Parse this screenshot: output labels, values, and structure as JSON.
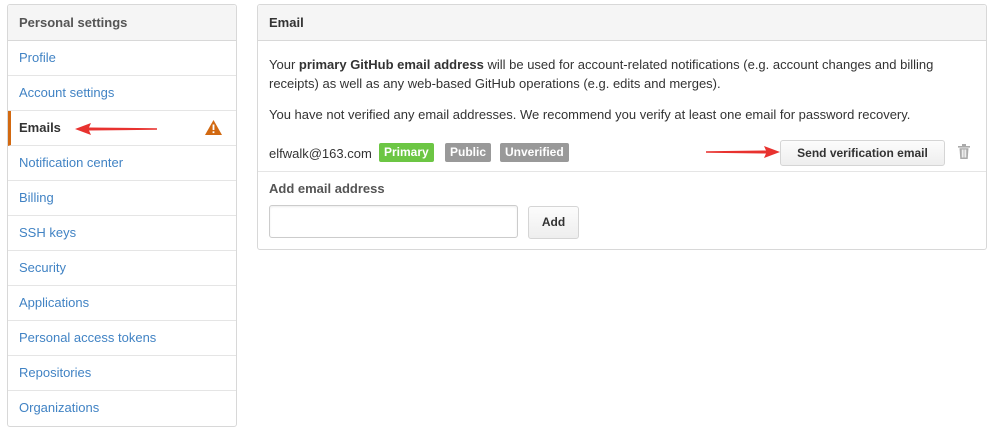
{
  "sidebar": {
    "header": "Personal settings",
    "items": [
      {
        "label": "Profile"
      },
      {
        "label": "Account settings"
      },
      {
        "label": "Emails"
      },
      {
        "label": "Notification center"
      },
      {
        "label": "Billing"
      },
      {
        "label": "SSH keys"
      },
      {
        "label": "Security"
      },
      {
        "label": "Applications"
      },
      {
        "label": "Personal access tokens"
      },
      {
        "label": "Repositories"
      },
      {
        "label": "Organizations"
      }
    ],
    "selected": "Emails"
  },
  "email_panel": {
    "title": "Email",
    "intro_prefix": "Your ",
    "intro_bold": "primary GitHub email address",
    "intro_suffix": " will be used for account-related notifications (e.g. account changes and billing receipts) as well as any web-based GitHub operations (e.g. edits and merges).",
    "verify_notice": "You have not verified any email addresses. We recommend you verify at least one email for password recovery.",
    "email": {
      "address": "elfwalk@163.com",
      "labels": [
        "Primary",
        "Public",
        "Unverified"
      ]
    },
    "send_verification_label": "Send verification email",
    "add_email_label": "Add email address",
    "add_input_value": "",
    "add_button_label": "Add"
  },
  "colors": {
    "link": "#4183c4",
    "primary_badge": "#6cc644",
    "neutral_badge": "#999999",
    "warning": "#d26911",
    "annotation_arrow": "#e8322f"
  },
  "icons": [
    "warning-icon",
    "trash-icon",
    "annotation-arrow"
  ]
}
